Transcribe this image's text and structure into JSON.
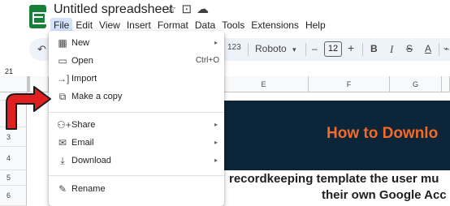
{
  "app": {
    "title": "Untitled spreadsheet",
    "icons": [
      "star-icon",
      "move-to-folder-icon",
      "cloud-status-icon"
    ]
  },
  "menubar": [
    "File",
    "Edit",
    "View",
    "Insert",
    "Format",
    "Data",
    "Tools",
    "Extensions",
    "Help"
  ],
  "toolbar": {
    "undo": "↶",
    "number_format": "123",
    "font": "Roboto",
    "font_caret": "▾",
    "minus": "–",
    "font_size": "12",
    "plus": "+",
    "bold": "B",
    "italic": "I",
    "strike": "S",
    "text_color": "A",
    "more": "⌁"
  },
  "name_box": "21",
  "columns": [
    "E",
    "F",
    "G"
  ],
  "rows": [
    "2",
    "3",
    "4",
    "5",
    "6"
  ],
  "banner": {
    "text": "How to Downlo",
    "background": "#0c2538",
    "text_color": "#f26b2a"
  },
  "body_text": {
    "line1": "recordkeeping template the user mu",
    "line2": "their own Google Acc"
  },
  "file_menu": {
    "items": [
      {
        "label": "New",
        "icon": "new-sheet-icon",
        "glyph": "▦",
        "submenu": true
      },
      {
        "label": "Open",
        "icon": "folder-icon",
        "glyph": "▭",
        "shortcut": "Ctrl+O"
      },
      {
        "label": "Import",
        "icon": "import-icon",
        "glyph": "→]"
      },
      {
        "label": "Make a copy",
        "icon": "copy-icon",
        "glyph": "⧉"
      },
      {
        "label": "Share",
        "icon": "share-icon",
        "glyph": "⚇+",
        "submenu": true
      },
      {
        "label": "Email",
        "icon": "email-icon",
        "glyph": "✉",
        "submenu": true
      },
      {
        "label": "Download",
        "icon": "download-icon",
        "glyph": "⤓",
        "submenu": true
      },
      {
        "label": "Rename",
        "icon": "rename-icon",
        "glyph": "✎"
      }
    ],
    "submenu_glyph": "▸"
  },
  "colors": {
    "arrow": "#e02020",
    "accent": "#188038",
    "menu_active": "#d3e3fd"
  }
}
